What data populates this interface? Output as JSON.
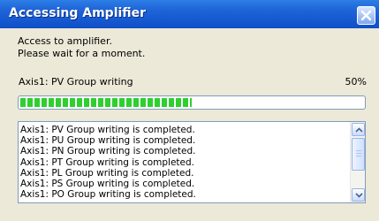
{
  "window": {
    "title": "Accessing Amplifier"
  },
  "message": {
    "line1": "Access to amplifier.",
    "line2": "Please wait for a moment."
  },
  "progress": {
    "status_label": "Axis1: PV Group writing",
    "percent_label": "50%",
    "value": 0.5
  },
  "log": {
    "lines": [
      "Axis1: PV Group writing is completed.",
      "Axis1: PU Group writing is completed.",
      "Axis1: PN Group writing is completed.",
      "Axis1: PT Group writing is completed.",
      "Axis1: PL Group writing is completed.",
      "Axis1: PS Group writing is completed.",
      "Axis1: PO Group writing is completed."
    ]
  },
  "icons": {
    "close": "close-icon",
    "scroll_up": "chevron-up-icon",
    "scroll_down": "chevron-down-icon"
  },
  "colors": {
    "titlebar": "#0f4fc9",
    "progress_fill": "#2fcf2f",
    "dialog_bg": "#ece9d8"
  }
}
